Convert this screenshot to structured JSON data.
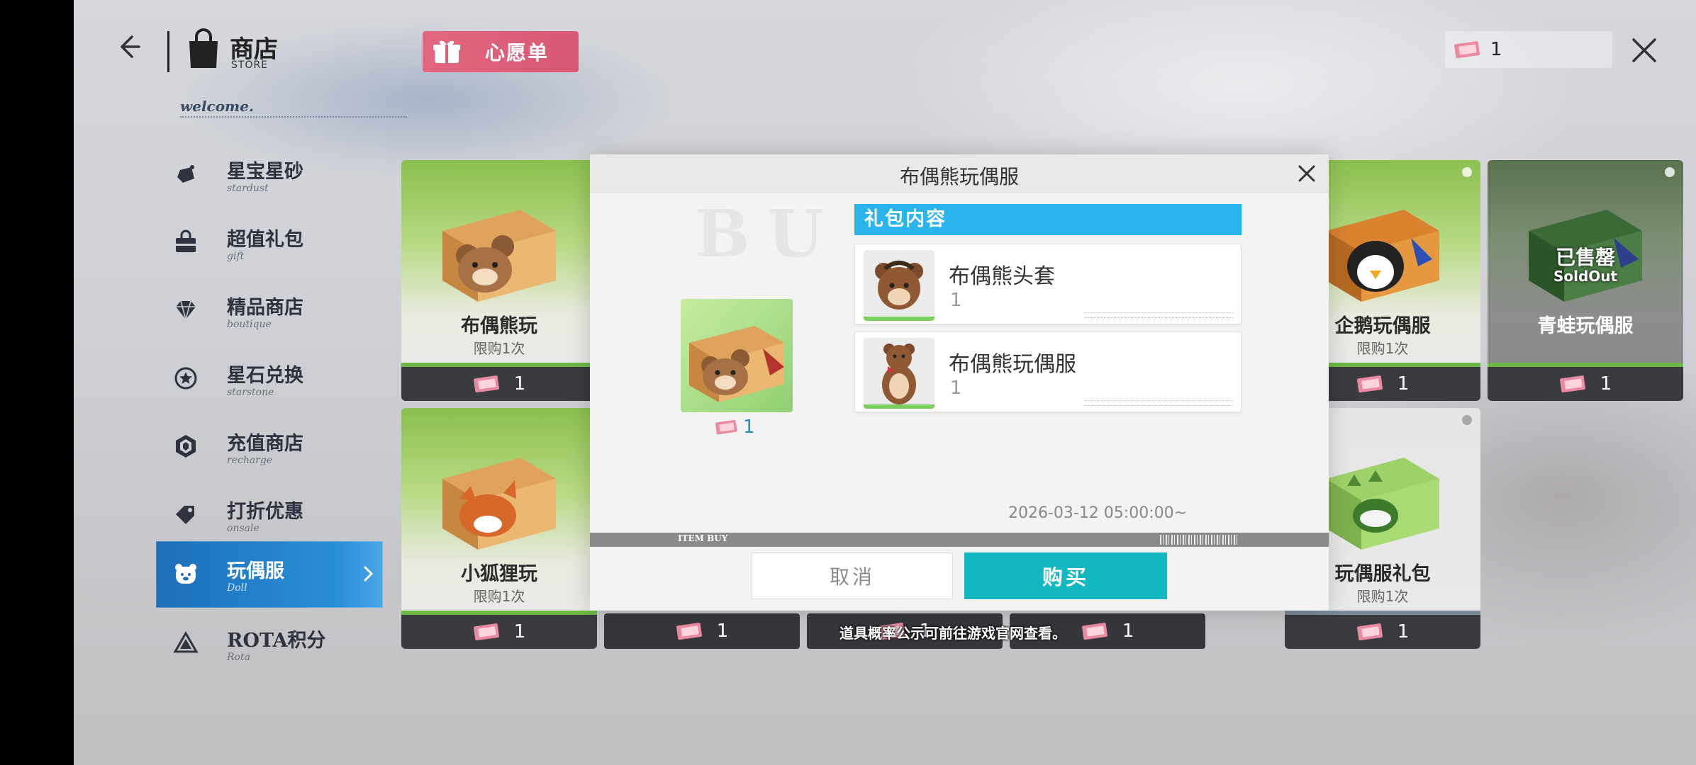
{
  "header": {
    "store_title": "商店",
    "store_subtitle": "STORE",
    "wishlist_label": "心愿单",
    "currency_amount": "1"
  },
  "sidebar": {
    "welcome": "welcome.",
    "items": [
      {
        "label": "星宝星砂",
        "sub": "stardust",
        "icon": "stardust-icon"
      },
      {
        "label": "超值礼包",
        "sub": "gift",
        "icon": "gift-bag-icon"
      },
      {
        "label": "精品商店",
        "sub": "boutique",
        "icon": "diamond-icon"
      },
      {
        "label": "星石兑换",
        "sub": "starstone",
        "icon": "star-coin-icon"
      },
      {
        "label": "充值商店",
        "sub": "recharge",
        "icon": "hexagon-gem-icon"
      },
      {
        "label": "打折优惠",
        "sub": "onsale",
        "icon": "price-tag-icon"
      },
      {
        "label": "玩偶服",
        "sub": "Doll",
        "icon": "bear-face-icon",
        "active": true
      },
      {
        "label": "ROTA积分",
        "sub": "Rota",
        "icon": "rota-icon"
      }
    ]
  },
  "cards": [
    {
      "name": "布偶熊玩",
      "limit": "限购1次",
      "price": "1"
    },
    {
      "name": "企鹅玩偶服",
      "limit": "限购1次",
      "price": "1"
    },
    {
      "name": "青蛙玩偶服",
      "sold_out": "已售罄",
      "sold_out_en": "SoldOut",
      "price": "1"
    },
    {
      "name": "小狐狸玩",
      "limit": "限购1次",
      "price": "1"
    },
    {
      "name": "玩偶服礼包",
      "limit": "限购1次",
      "price": "1"
    }
  ],
  "price_bars": [
    "1",
    "1",
    "1"
  ],
  "modal": {
    "title": "布偶熊玩偶服",
    "watermark": "BU",
    "item_price": "1",
    "contents_header": "礼包内容",
    "contents": [
      {
        "name": "布偶熊头套",
        "qty": "1"
      },
      {
        "name": "布偶熊玩偶服",
        "qty": "1"
      }
    ],
    "timestamp": "2026-03-12 05:00:00~",
    "item_buy_label": "ITEM BUY",
    "cancel_label": "取消",
    "buy_label": "购买"
  },
  "notice": "道具概率公示可前往游戏官网查看。",
  "colors": {
    "accent_blue": "#2ab4ec",
    "buy_teal": "#13b7c0",
    "wishlist_pink": "#de6079",
    "sidebar_active": "#1d6fb8"
  }
}
